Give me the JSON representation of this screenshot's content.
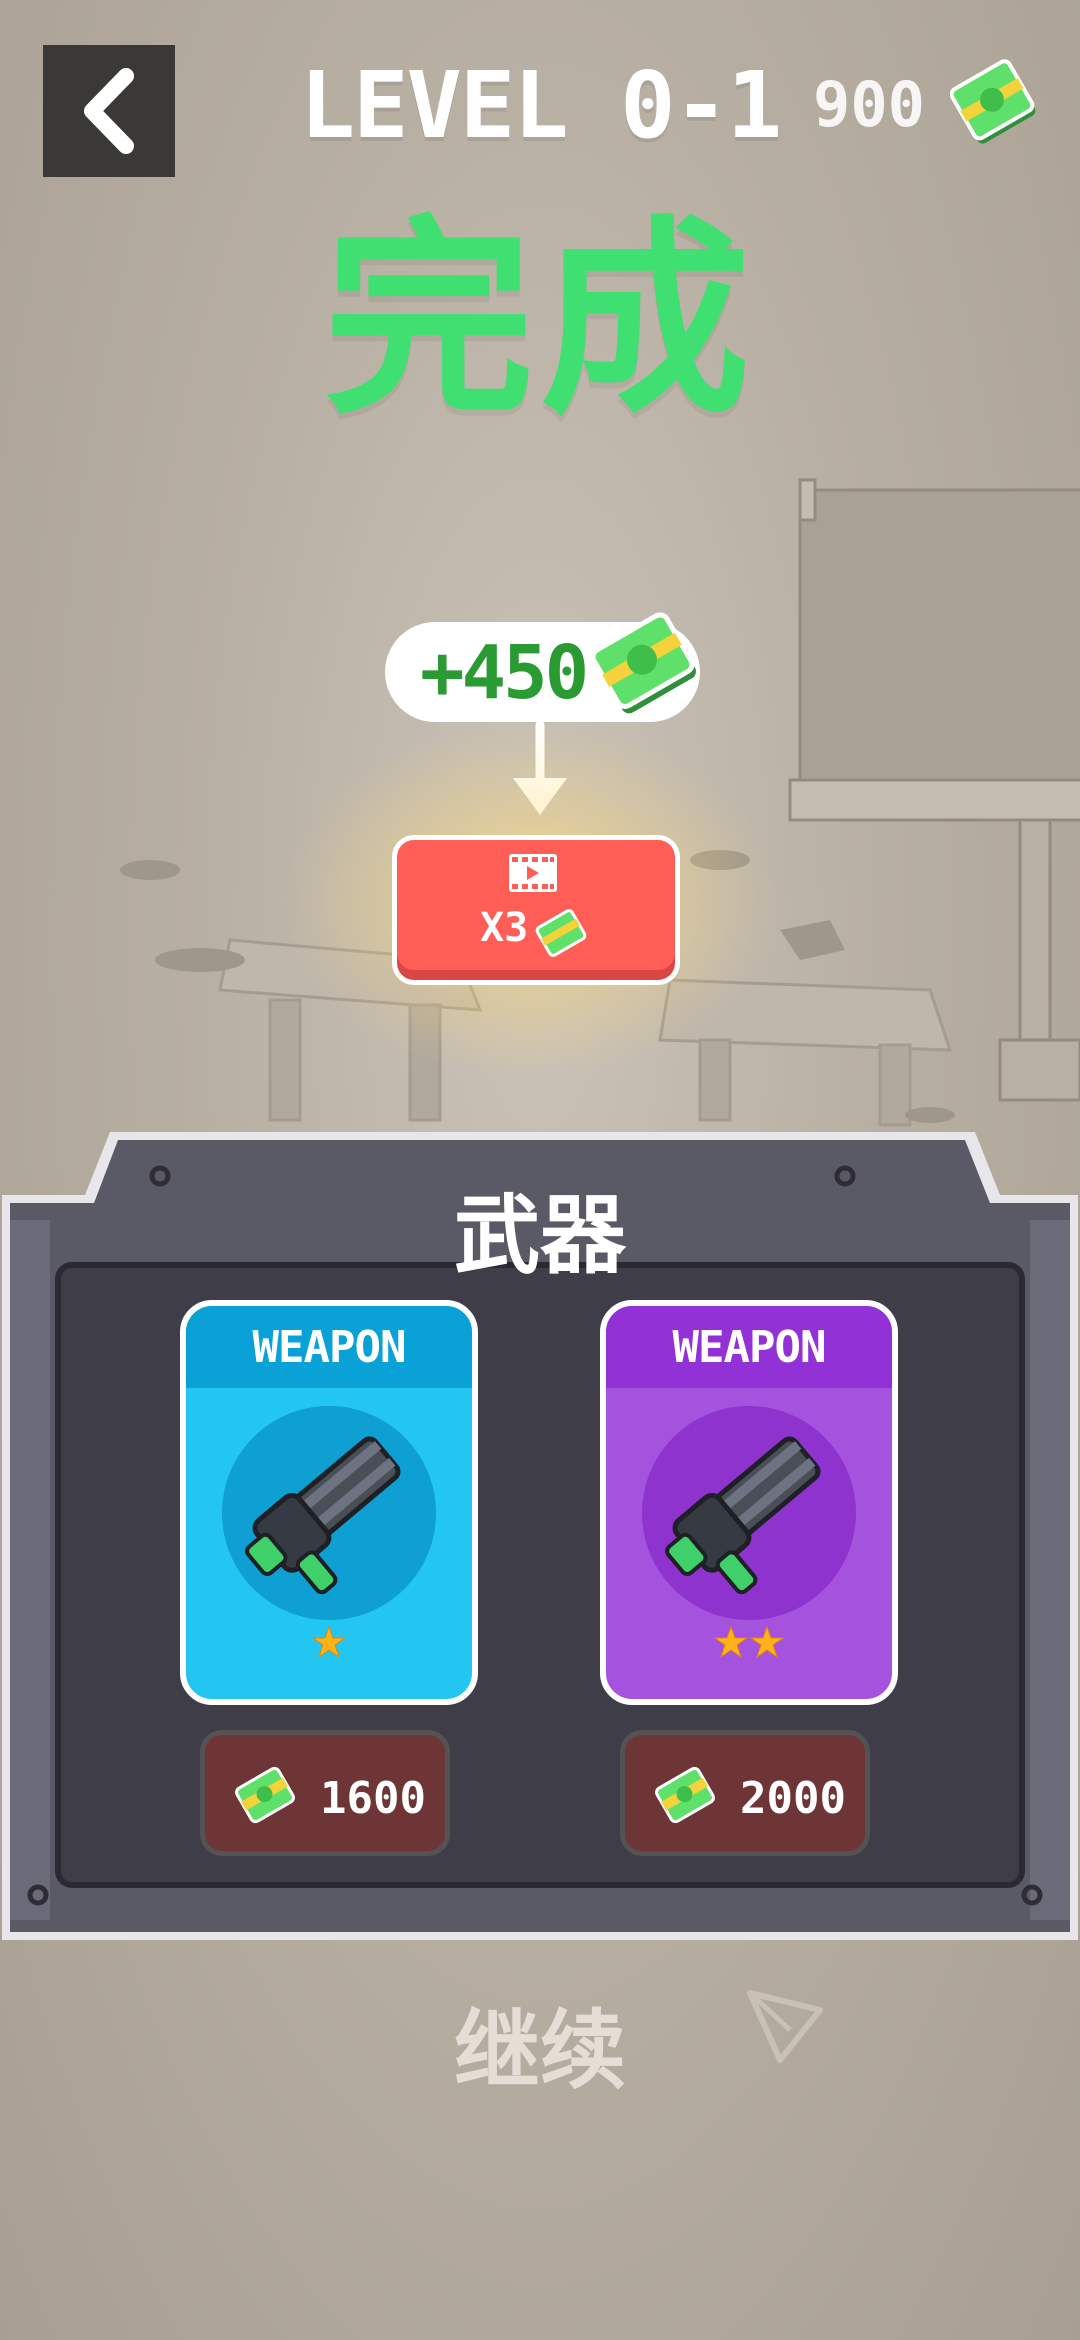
{
  "header": {
    "back_icon": "chevron-left-icon",
    "level_title": "LEVEL 0-1",
    "coin_count": "900",
    "complete_title": "完成"
  },
  "reward": {
    "amount_text": "+450",
    "video_button_label": "X3",
    "video_icon": "film-play-icon"
  },
  "weapons_panel": {
    "title": "武器",
    "cards": [
      {
        "header": "WEAPON",
        "stars": 1,
        "price": "1600",
        "theme": "#22c6f0",
        "head_color": "#0aa2d6",
        "circle": "#0e9fd3"
      },
      {
        "header": "WEAPON",
        "stars": 2,
        "price": "2000",
        "theme": "#a553de",
        "head_color": "#9232d6",
        "circle": "#8f33cf"
      }
    ]
  },
  "continue_label": "继续",
  "colors": {
    "accent_green": "#3fe071",
    "reward_green": "#2a9a33",
    "video_red": "#ff5e57",
    "panel_dark": "#3f3e48",
    "price_bg": "#6d3536"
  }
}
